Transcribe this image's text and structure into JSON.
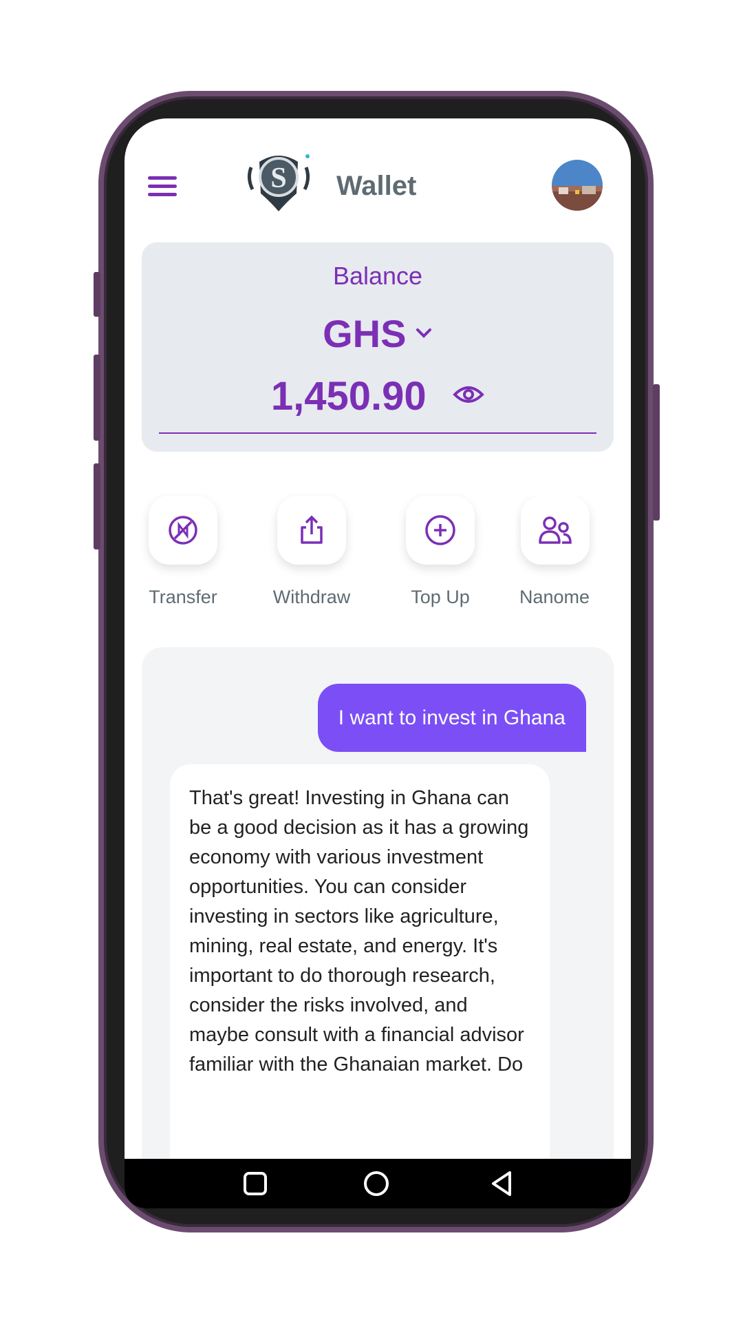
{
  "header": {
    "title": "Wallet"
  },
  "balance": {
    "label": "Balance",
    "currency": "GHS",
    "amount": "1,450.90"
  },
  "actions": [
    {
      "label": "Transfer",
      "icon": "no-transfer-icon"
    },
    {
      "label": "Withdraw",
      "icon": "share-upload-icon"
    },
    {
      "label": "Top Up",
      "icon": "plus-circle-icon"
    },
    {
      "label": "Nanome",
      "icon": "people-icon"
    }
  ],
  "chat": {
    "user_message": "I want to invest in Ghana",
    "bot_message": "That's great! Investing in Ghana can be a good decision as it has a growing economy with various investment opportunities. You can consider investing in sectors like agriculture, mining, real estate, and energy. It's important to do thorough research, consider the risks involved, and maybe consult with a financial advisor familiar with the Ghanaian market. Do"
  },
  "colors": {
    "accent": "#7b2fb5",
    "user_bubble": "#7b4ff5",
    "card_bg": "#e7eaef",
    "frame": "#6b4c6f"
  }
}
